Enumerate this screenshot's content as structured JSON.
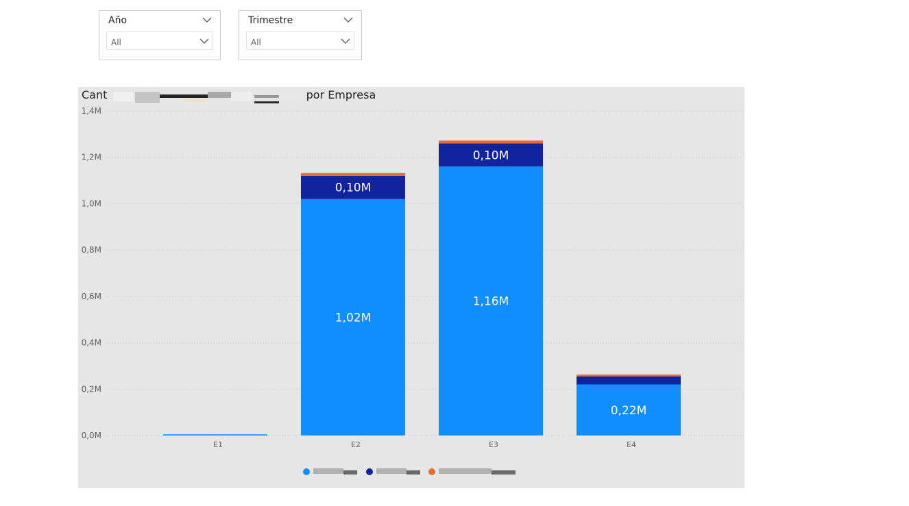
{
  "slicers": [
    {
      "title": "Año",
      "value": "All"
    },
    {
      "title": "Trimestre",
      "value": "All"
    }
  ],
  "colors": {
    "series1": "#118dff",
    "series2": "#12239e",
    "series3": "#e66c37",
    "visual_bg": "#e6e6e6",
    "grid": "#c8c8c8",
    "axis_text": "#605e5c"
  },
  "chart_data": {
    "type": "bar",
    "stacked": true,
    "title_prefix": "Cant",
    "title_suffix": "por Empresa",
    "categories": [
      "E1",
      "E2",
      "E3",
      "E4"
    ],
    "series": [
      {
        "color": "#118dff",
        "values": [
          0.005,
          1.02,
          1.16,
          0.22
        ],
        "labels": [
          "",
          "1,02M",
          "1,16M",
          "0,22M"
        ]
      },
      {
        "color": "#12239e",
        "values": [
          0.0,
          0.1,
          0.1,
          0.035
        ],
        "labels": [
          "",
          "0,10M",
          "0,10M",
          ""
        ]
      },
      {
        "color": "#e66c37",
        "values": [
          0.0,
          0.012,
          0.012,
          0.008
        ],
        "labels": [
          "",
          "",
          "",
          ""
        ]
      }
    ],
    "ylim": [
      0,
      1.4
    ],
    "yticks": [
      "0,0M",
      "0,2M",
      "0,4M",
      "0,6M",
      "0,8M",
      "1,0M",
      "1,2M",
      "1,4M"
    ],
    "grid": true,
    "legend_position": "bottom-center"
  }
}
